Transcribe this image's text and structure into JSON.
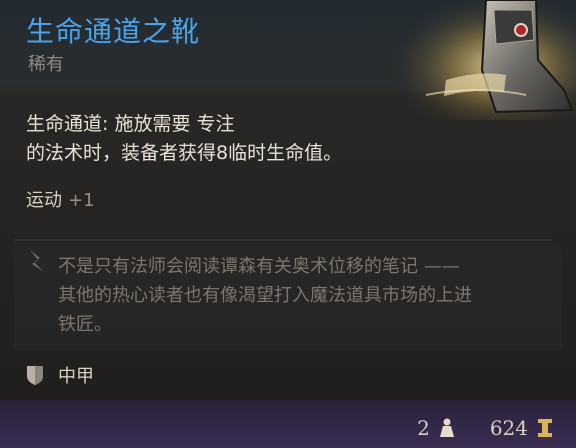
{
  "item": {
    "title": "生命通道之靴",
    "rarity": "稀有",
    "description_line1": "生命通道: 施放需要 专注",
    "description_line2": "的法术时，装备者获得8临时生命值。",
    "skill": {
      "name": "运动",
      "bonus": "+1"
    },
    "lore_line1": "不是只有法师会阅读谭森有关奥术位移的笔记 ——",
    "lore_line2": "其他的热心读者也有像渴望打入魔法道具市场的上进",
    "lore_line3": "铁匠。",
    "armor_type": "中甲",
    "weight": "2",
    "value": "624"
  },
  "icons": {
    "lore": "quill-icon",
    "armor": "shield-icon",
    "weight": "weight-icon",
    "value": "gold-icon"
  },
  "colors": {
    "title": "#4aa3e8",
    "rarity": "#8f8a83",
    "text": "#e9e2d6",
    "lore": "#7c766f",
    "footer": "#34284a"
  }
}
